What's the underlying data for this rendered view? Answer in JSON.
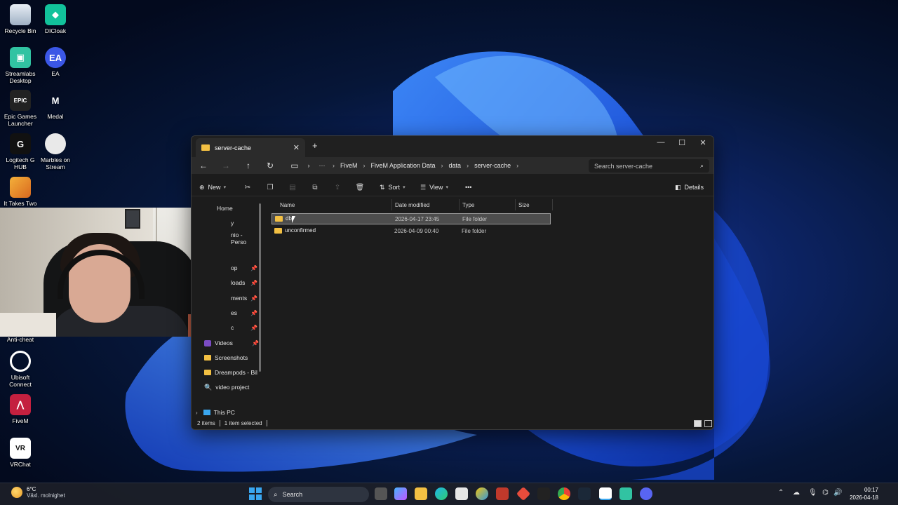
{
  "desktop": {
    "icons": [
      {
        "label": "Recycle Bin"
      },
      {
        "label": "DICloak"
      },
      {
        "label": "Streamlabs Desktop"
      },
      {
        "label": "EA"
      },
      {
        "label": "Epic Games Launcher"
      },
      {
        "label": "Medal"
      },
      {
        "label": "Logitech G HUB"
      },
      {
        "label": "Marbles on Stream"
      },
      {
        "label": "It Takes Two"
      },
      {
        "label": "Anti-cheat"
      },
      {
        "label": "Ubisoft Connect"
      },
      {
        "label": "FiveM"
      },
      {
        "label": "VRChat"
      }
    ],
    "icon_glyphs": {
      "ea": "EA",
      "epic": "EPIC",
      "medal": "M",
      "logitech": "G",
      "vr": "VR"
    }
  },
  "explorer": {
    "tab_title": "server-cache",
    "breadcrumb": [
      "FiveM",
      "FiveM Application Data",
      "data",
      "server-cache"
    ],
    "search_placeholder": "Search server-cache",
    "toolbar": {
      "new_label": "New",
      "sort_label": "Sort",
      "view_label": "View",
      "more_label": "•••",
      "details_label": "Details"
    },
    "sidebar": {
      "home": "Home",
      "partial_items": [
        "y",
        "nio - Perso",
        "op",
        "loads",
        "ments",
        "es",
        "c"
      ],
      "items": [
        "Videos",
        "Screenshots",
        "Dreampods - Bil",
        "video project"
      ],
      "this_pc": "This PC"
    },
    "columns": {
      "name": "Name",
      "date": "Date modified",
      "type": "Type",
      "size": "Size"
    },
    "files": [
      {
        "name": "db",
        "date": "2026-04-17 23:45",
        "type": "File folder",
        "selected": true
      },
      {
        "name": "unconfirmed",
        "date": "2026-04-09 00:40",
        "type": "File folder",
        "selected": false
      }
    ],
    "status": {
      "count": "2 items",
      "selection": "1 item selected"
    }
  },
  "taskbar": {
    "weather_temp": "6°C",
    "weather_desc": "Växl. molnighet",
    "search_label": "Search",
    "time": "00:17",
    "date": "2026-04-18"
  },
  "colors": {
    "folder": "#f3c043",
    "accent": "#3aa7f0",
    "window_bg": "#1c1c1c"
  }
}
